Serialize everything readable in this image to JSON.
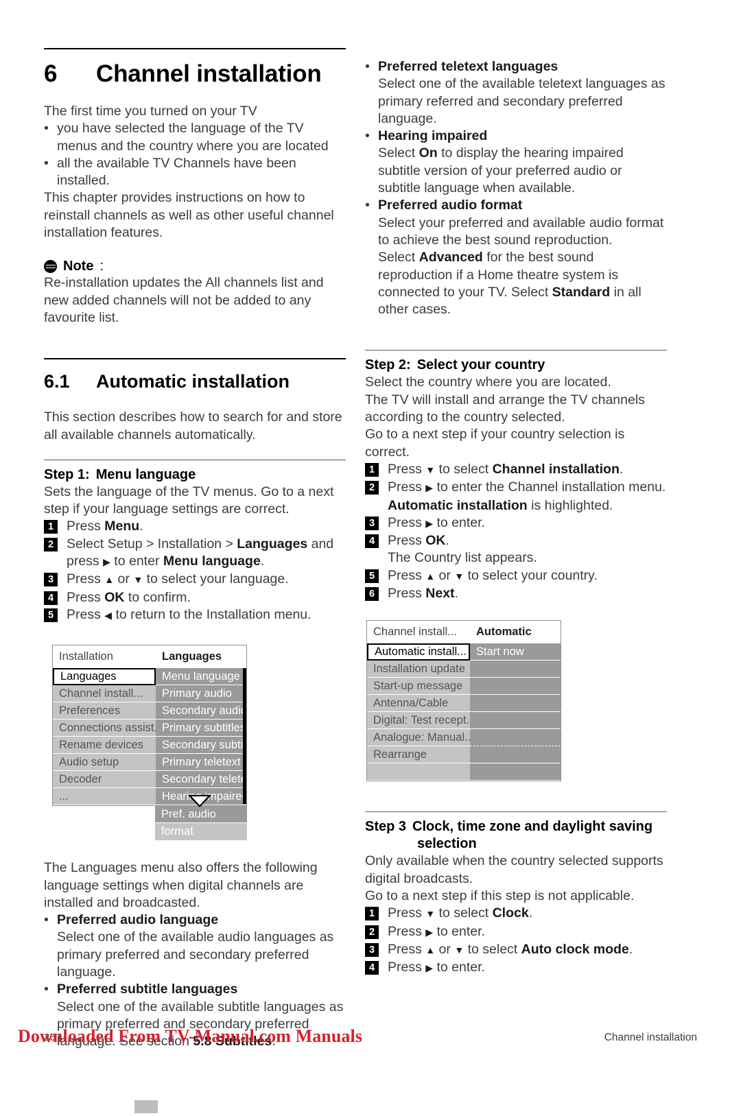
{
  "document": {
    "chapter_number": "6",
    "chapter_title": "Channel installation",
    "footer": {
      "page_number": "26",
      "running_head": "Channel installation",
      "watermark": "Downloaded From TV-Manual.com Manuals"
    }
  },
  "left_column": {
    "intro_line": "The first time you turned on your TV",
    "intro_bullets": [
      "you have selected the language of the TV menus and the country where you are located",
      "all the available TV Channels have been installed."
    ],
    "intro_tail": "This chapter provides instructions on how to reinstall channels as well as other useful channel installation features.",
    "note": {
      "icon": "note-icon",
      "label": "Note",
      "colon": ":",
      "body": "Re-installation updates the All channels list and new added channels will not be added to any favourite list."
    },
    "section": {
      "number": "6.1",
      "title": "Automatic installation",
      "body": "This section describes how to search for and store all available channels automatically."
    },
    "step1": {
      "heading_label": "Step 1:",
      "heading_text": "Menu language",
      "intro": "Sets the language of the TV menus. Go to a next step if your language settings are correct.",
      "items": [
        {
          "n": "1",
          "parts": [
            {
              "t": "Press ",
              "b": false
            },
            {
              "t": "Menu",
              "b": true
            },
            {
              "t": ".",
              "b": false
            }
          ]
        },
        {
          "n": "2",
          "parts": [
            {
              "t": "Select Setup > Installation > ",
              "b": false
            },
            {
              "t": "Languages",
              "b": true
            },
            {
              "t": " and",
              "b": false
            }
          ],
          "cont_parts": [
            {
              "t": "press ",
              "b": false
            },
            {
              "t": "▶",
              "b": false,
              "arrow": true
            },
            {
              "t": " to enter ",
              "b": false
            },
            {
              "t": "Menu language",
              "b": true
            },
            {
              "t": ".",
              "b": false
            }
          ]
        },
        {
          "n": "3",
          "parts": [
            {
              "t": "Press ",
              "b": false
            },
            {
              "t": "▲",
              "b": false,
              "arrow": true
            },
            {
              "t": " or ",
              "b": false
            },
            {
              "t": "▼",
              "b": false,
              "arrow": true
            },
            {
              "t": " to select your language.",
              "b": false
            }
          ]
        },
        {
          "n": "4",
          "parts": [
            {
              "t": "Press ",
              "b": false
            },
            {
              "t": "OK",
              "b": true
            },
            {
              "t": " to confirm.",
              "b": false
            }
          ]
        },
        {
          "n": "5",
          "parts": [
            {
              "t": "Press ",
              "b": false
            },
            {
              "t": "◀",
              "b": false,
              "arrow": true
            },
            {
              "t": " to return to the Installation menu.",
              "b": false
            }
          ]
        }
      ]
    },
    "menu_languages": {
      "header_left": "Installation",
      "header_right": "Languages",
      "left_items": [
        "Languages",
        "Channel install...",
        "Preferences",
        "Connections assist.",
        "Rename devices",
        "Audio setup",
        "Decoder",
        "..."
      ],
      "selected_left": "Languages",
      "right_items": [
        "Menu language",
        "Primary audio",
        "Secondary audio",
        "Primary subtitles",
        "Secondary subtitl..",
        "Primary teletext",
        "Secondary teletext",
        "Hearing impaired",
        "Pref. audio format"
      ],
      "caret_icon": "chevron-down-icon"
    },
    "after_menu": "The Languages menu also offers the following language settings when digital channels are installed and broadcasted.",
    "lang_bullets": [
      {
        "title": "Preferred audio language",
        "body": "Select one of the available audio languages as primary preferred and secondary preferred language."
      },
      {
        "title": "Preferred subtitle languages",
        "body_parts": [
          {
            "t": "Select one of the available subtitle languages as primary preferred and secondary preferred language. See section ",
            "b": false
          },
          {
            "t": "5.8 Subtitles",
            "b": true
          },
          {
            "t": ".",
            "b": false
          }
        ]
      }
    ]
  },
  "right_column": {
    "lang_bullets": [
      {
        "title": "Preferred teletext languages",
        "body": "Select one of the available teletext languages as primary referred and secondary preferred language."
      },
      {
        "title": "Hearing impaired",
        "body_parts": [
          {
            "t": "Select ",
            "b": false
          },
          {
            "t": "On",
            "b": true
          },
          {
            "t": " to display the hearing impaired subtitle version of your preferred audio or subtitle language when available.",
            "b": false
          }
        ]
      },
      {
        "title": "Preferred audio format",
        "body_parts": [
          {
            "t": "Select your preferred and available audio format to achieve the best sound reproduction.",
            "b": false
          }
        ],
        "body_parts2": [
          {
            "t": "Select ",
            "b": false
          },
          {
            "t": "Advanced",
            "b": true
          },
          {
            "t": " for the best sound reproduction if a Home theatre system is connected to your TV. Select ",
            "b": false
          },
          {
            "t": "Standard",
            "b": true
          },
          {
            "t": " in all other cases.",
            "b": false
          }
        ]
      }
    ],
    "step2": {
      "heading_label": "Step 2:",
      "heading_text": "Select your country",
      "intro": "Select the country where you are located.\nThe TV will install and arrange the TV channels according to the country selected.\nGo to a next step if your country selection is correct.",
      "items": [
        {
          "n": "1",
          "parts": [
            {
              "t": "Press ",
              "b": false
            },
            {
              "t": "▼",
              "b": false,
              "arrow": true
            },
            {
              "t": " to select ",
              "b": false
            },
            {
              "t": "Channel installation",
              "b": true
            },
            {
              "t": ".",
              "b": false
            }
          ]
        },
        {
          "n": "2",
          "parts": [
            {
              "t": "Press ",
              "b": false
            },
            {
              "t": "▶",
              "b": false,
              "arrow": true
            },
            {
              "t": " to enter the Channel installation menu.",
              "b": false
            }
          ],
          "cont_parts": [
            {
              "t": "Automatic installation",
              "b": true
            },
            {
              "t": " is highlighted.",
              "b": false
            }
          ]
        },
        {
          "n": "3",
          "parts": [
            {
              "t": "Press ",
              "b": false
            },
            {
              "t": "▶",
              "b": false,
              "arrow": true
            },
            {
              "t": " to enter.",
              "b": false
            }
          ]
        },
        {
          "n": "4",
          "parts": [
            {
              "t": "Press ",
              "b": false
            },
            {
              "t": "OK",
              "b": true
            },
            {
              "t": ".",
              "b": false
            }
          ],
          "cont_parts": [
            {
              "t": "The Country list appears.",
              "b": false
            }
          ]
        },
        {
          "n": "5",
          "parts": [
            {
              "t": "Press ",
              "b": false
            },
            {
              "t": "▲",
              "b": false,
              "arrow": true
            },
            {
              "t": " or ",
              "b": false
            },
            {
              "t": "▼",
              "b": false,
              "arrow": true
            },
            {
              "t": " to select your country.",
              "b": false
            }
          ]
        },
        {
          "n": "6",
          "parts": [
            {
              "t": "Press ",
              "b": false
            },
            {
              "t": "Next",
              "b": true
            },
            {
              "t": ".",
              "b": false
            }
          ]
        }
      ]
    },
    "menu_channel": {
      "header_left": "Channel install...",
      "header_right": "Automatic install...",
      "left_items": [
        "Automatic install...",
        "Installation update",
        "Start-up message",
        "Antenna/Cable",
        "Digital: Test recept...",
        "Analogue: Manual...",
        "Rearrange",
        ""
      ],
      "selected_left": "Automatic install...",
      "right_items": [
        "Start now",
        "",
        "",
        "",
        "",
        "",
        "",
        ""
      ]
    },
    "step3": {
      "heading_label": "Step 3",
      "heading_text": "Clock, time zone and daylight saving",
      "heading_text2": "selection",
      "intro": "Only available when the country selected supports digital broadcasts.\nGo to a next step if this step is not applicable.",
      "items": [
        {
          "n": "1",
          "parts": [
            {
              "t": "Press ",
              "b": false
            },
            {
              "t": "▼",
              "b": false,
              "arrow": true
            },
            {
              "t": " to select ",
              "b": false
            },
            {
              "t": "Clock",
              "b": true
            },
            {
              "t": ".",
              "b": false
            }
          ]
        },
        {
          "n": "2",
          "parts": [
            {
              "t": "Press ",
              "b": false
            },
            {
              "t": "▶",
              "b": false,
              "arrow": true
            },
            {
              "t": " to enter.",
              "b": false
            }
          ]
        },
        {
          "n": "3",
          "parts": [
            {
              "t": "Press ",
              "b": false
            },
            {
              "t": "▲",
              "b": false,
              "arrow": true
            },
            {
              "t": " or ",
              "b": false
            },
            {
              "t": "▼",
              "b": false,
              "arrow": true
            },
            {
              "t": " to select ",
              "b": false
            },
            {
              "t": "Auto clock mode",
              "b": true
            },
            {
              "t": ".",
              "b": false
            }
          ]
        },
        {
          "n": "4",
          "parts": [
            {
              "t": "Press ",
              "b": false
            },
            {
              "t": "▶",
              "b": false,
              "arrow": true
            },
            {
              "t": " to enter.",
              "b": false
            }
          ]
        }
      ]
    }
  },
  "colors": {
    "watermark_red": "#d8202a",
    "menu_left_bg": "#c4c4c4",
    "menu_right_bg": "#9a9a9a"
  }
}
